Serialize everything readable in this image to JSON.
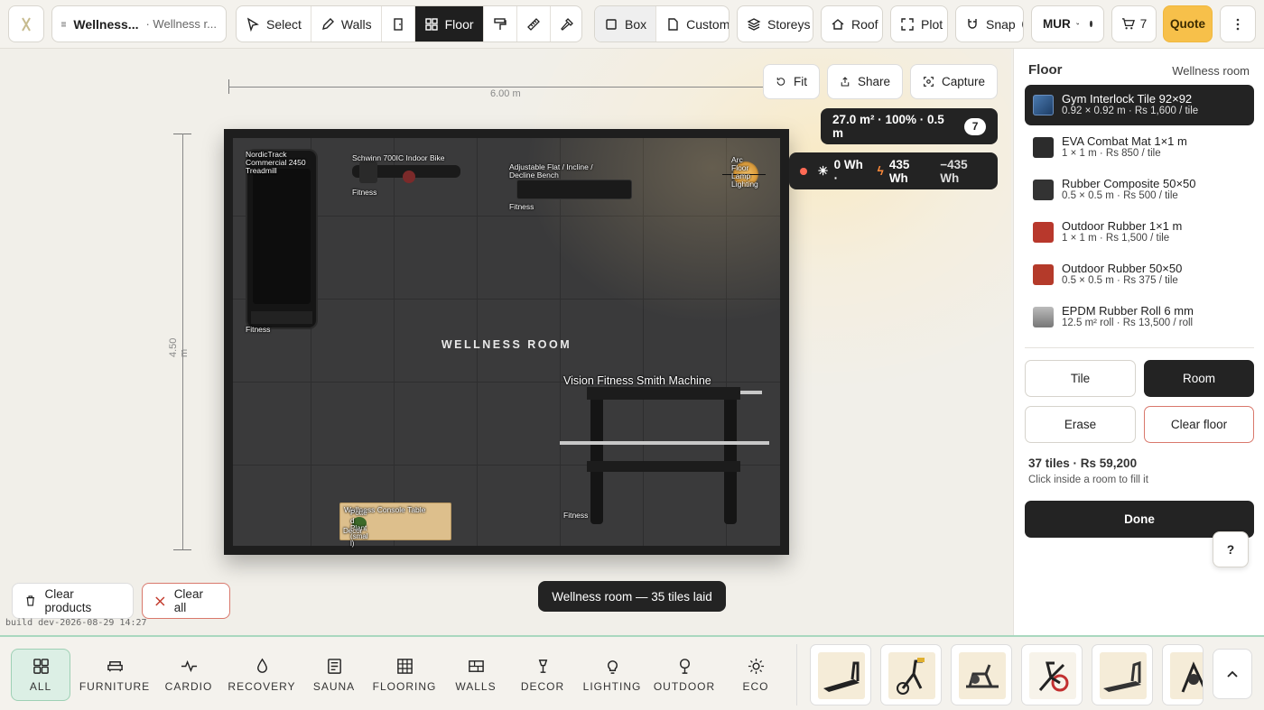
{
  "toolbar": {
    "project_name": "Wellness...",
    "project_sub": "· Wellness r...",
    "tools": [
      {
        "label": "Select",
        "icon": "cursor-icon"
      },
      {
        "label": "Walls",
        "icon": "pencil-icon"
      },
      {
        "label": "",
        "icon": "door-icon"
      },
      {
        "label": "Floor",
        "icon": "grid-icon",
        "active": true
      },
      {
        "label": "",
        "icon": "paint-roller-icon"
      },
      {
        "label": "",
        "icon": "ruler-icon"
      },
      {
        "label": "",
        "icon": "hammer-icon"
      }
    ],
    "box_label": "Box",
    "custom_label": "Custom",
    "storeys_label": "Storeys",
    "roof_label": "Roof",
    "plot_label": "Plot",
    "snap_label": "Snap",
    "currency": "MUR",
    "cart_count": "7",
    "quote_label": "Quote"
  },
  "canvas": {
    "fit_label": "Fit",
    "share_label": "Share",
    "capture_label": "Capture",
    "stats": "27.0 m² · 100% · 0.5 m",
    "stats_badge": "7",
    "energy_solar": "0 Wh ·",
    "energy_use": "435 Wh",
    "energy_net": "−435 Wh",
    "dim_width": "6.00 m",
    "dim_height": "4.50 m",
    "room_name": "WELLNESS ROOM",
    "products": {
      "treadmill": "NordicTrack\nCommercial 2450\nTreadmill",
      "bike": "Schwinn 700IC Indoor Bike",
      "bench": "Adjustable Flat / Incline /\nDecline Bench",
      "lamp": "Arc\nFloor\nLamp\nLighting",
      "smith": "Vision Fitness Smith Machine",
      "console": "Wellness Console Table",
      "plant": "Potte\nd\nPlant\n(smal\nl)",
      "plant_cat": "Decor",
      "fitness": "Fitness"
    },
    "clear_products": "Clear products",
    "clear_all": "Clear all",
    "build": "build dev-2026-08-29 14:27",
    "toast": "Wellness room — 35 tiles laid"
  },
  "panel": {
    "title": "Floor",
    "room": "Wellness room",
    "materials": [
      {
        "name": "Gym Interlock Tile 92×92",
        "spec": "0.92 × 0.92 m · Rs 1,600 / tile",
        "color": "#2f5a8a",
        "selected": true
      },
      {
        "name": "EVA Combat Mat 1×1 m",
        "spec": "1 × 1 m · Rs 850 / tile",
        "color": "#2c2c2c"
      },
      {
        "name": "Rubber Composite 50×50",
        "spec": "0.5 × 0.5 m · Rs 500 / tile",
        "color": "#333333"
      },
      {
        "name": "Outdoor Rubber 1×1 m",
        "spec": "1 × 1 m · Rs 1,500 / tile",
        "color": "#b8382c"
      },
      {
        "name": "Outdoor Rubber 50×50",
        "spec": "0.5 × 0.5 m · Rs 375 / tile",
        "color": "#b43a2a"
      },
      {
        "name": "EPDM Rubber Roll 6 mm",
        "spec": "12.5 m² roll · Rs 13,500 / roll",
        "color": "#8a8a8a"
      }
    ],
    "tile_label": "Tile",
    "room_label": "Room",
    "erase_label": "Erase",
    "clear_floor_label": "Clear floor",
    "summary": "37 tiles · Rs 59,200",
    "hint": "Click inside a room to fill it",
    "done_label": "Done",
    "help": "?"
  },
  "categories": [
    {
      "label": "ALL",
      "icon": "grid-four-icon",
      "active": true
    },
    {
      "label": "FURNITURE",
      "icon": "sofa-icon"
    },
    {
      "label": "CARDIO",
      "icon": "pulse-icon"
    },
    {
      "label": "RECOVERY",
      "icon": "drop-icon"
    },
    {
      "label": "SAUNA",
      "icon": "sauna-icon"
    },
    {
      "label": "FLOORING",
      "icon": "tiles-icon"
    },
    {
      "label": "WALLS",
      "icon": "brick-icon"
    },
    {
      "label": "DECOR",
      "icon": "lamp-icon"
    },
    {
      "label": "LIGHTING",
      "icon": "bulb-icon"
    },
    {
      "label": "OUTDOOR",
      "icon": "tree-icon"
    },
    {
      "label": "ECO",
      "icon": "sun-icon"
    }
  ]
}
